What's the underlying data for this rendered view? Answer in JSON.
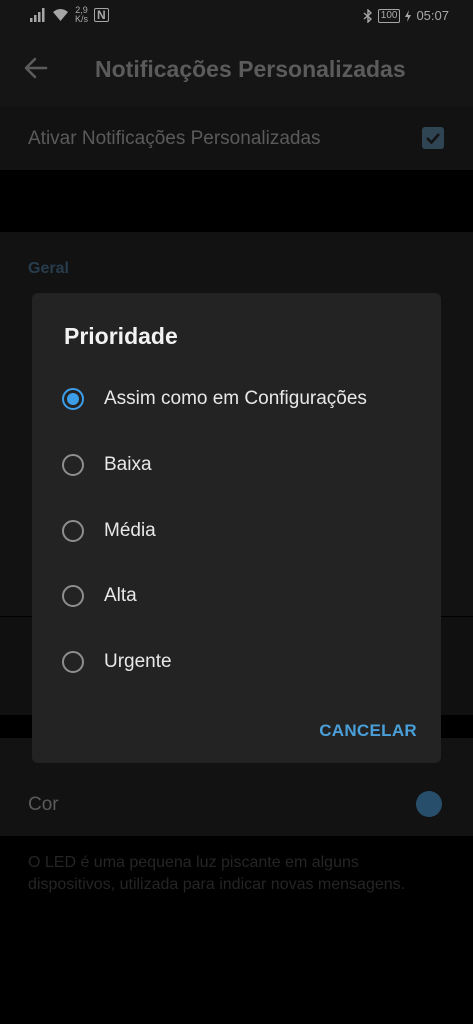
{
  "status_bar": {
    "speed_value": "2,9",
    "speed_unit": "K/s",
    "nfc": "N",
    "battery": "100",
    "time": "05:07"
  },
  "app_bar": {
    "title": "Notificações Personalizadas"
  },
  "settings": {
    "enable_label": "Ativar Notificações Personalizadas",
    "enable_checked": true,
    "general_header": "Geral",
    "led_color_label": "Cor",
    "led_color": "#3d7aa6",
    "led_description": "O LED é uma pequena luz piscante em alguns dispositivos, utilizada para indicar novas mensagens."
  },
  "dialog": {
    "title": "Prioridade",
    "options": [
      {
        "label": "Assim como em Configurações",
        "selected": true
      },
      {
        "label": "Baixa",
        "selected": false
      },
      {
        "label": "Média",
        "selected": false
      },
      {
        "label": "Alta",
        "selected": false
      },
      {
        "label": "Urgente",
        "selected": false
      }
    ],
    "cancel_label": "CANCELAR"
  },
  "colors": {
    "accent": "#3d9ee8",
    "dialog_bg": "#232323",
    "toolbar_bg": "#212121"
  }
}
